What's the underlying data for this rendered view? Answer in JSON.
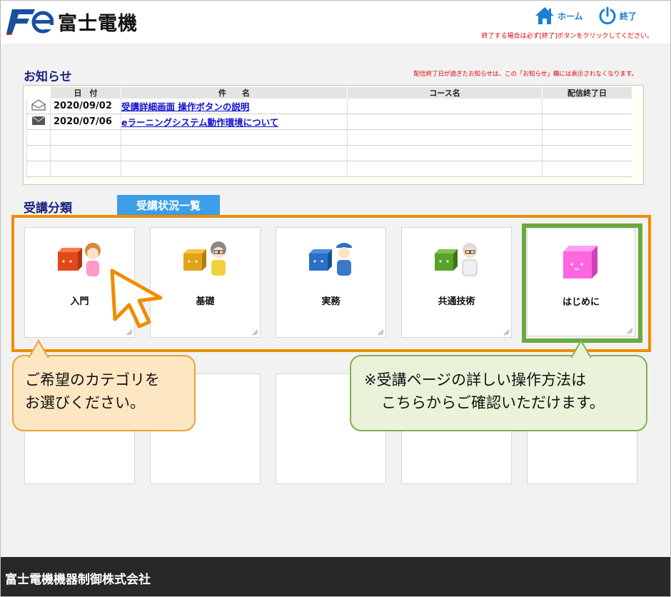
{
  "header": {
    "logo_text": "富士電機",
    "home_label": "ホーム",
    "exit_label": "終了",
    "exit_note": "終了する場合は必ず[終了]ボタンをクリックしてください。"
  },
  "news": {
    "title": "お知らせ",
    "note": "配信終了日が過ぎたお知らせは、この「お知らせ」欄には表示されなくなります。",
    "columns": [
      "日　付",
      "件　　名",
      "コース名",
      "配信終了日"
    ],
    "rows": [
      {
        "icon": "envelope-open-icon",
        "date": "2020/09/02",
        "subject": "受講詳細画面 操作ボタンの説明",
        "course": "",
        "end_date": ""
      },
      {
        "icon": "envelope-closed-icon",
        "date": "2020/07/06",
        "subject": "eラーニングシステム動作環境について",
        "course": "",
        "end_date": ""
      }
    ]
  },
  "categories": {
    "title": "受講分類",
    "status_tab": "受講状況一覧",
    "items": [
      {
        "label": "入門",
        "cube_color": "#e04a1a"
      },
      {
        "label": "基礎",
        "cube_color": "#e3a41a"
      },
      {
        "label": "実務",
        "cube_color": "#2a6fc4"
      },
      {
        "label": "共通技術",
        "cube_color": "#5aa12a"
      },
      {
        "label": "はじめに",
        "cube_color": "#ff66e0"
      }
    ]
  },
  "callouts": {
    "orange_line1": "ご希望のカテゴリを",
    "orange_line2": "お選びください。",
    "green_line1": "※受講ページの詳しい操作方法は",
    "green_line2": "こちらからご確認いただけます。"
  },
  "footer": {
    "company": "富士電機機器制御株式会社"
  },
  "colors": {
    "accent_blue": "#3a9ee8",
    "highlight_orange": "#f08c00",
    "highlight_green": "#6aaa3f",
    "heading_navy": "#1a237e",
    "note_red": "#e00000"
  }
}
